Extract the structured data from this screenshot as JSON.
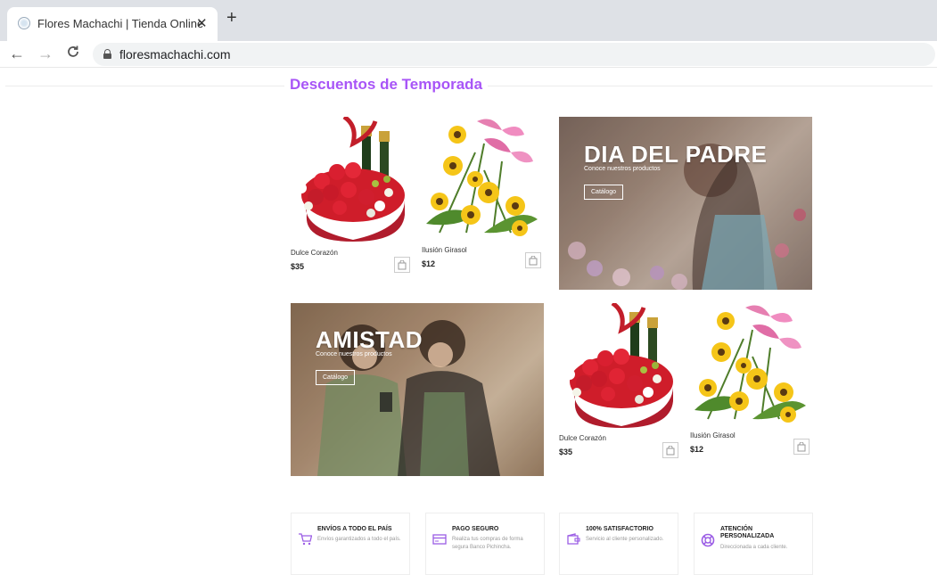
{
  "browser": {
    "tab_title": "Flores Machachi | Tienda Online",
    "tab_close": "✕",
    "new_tab": "+",
    "back": "←",
    "forward": "→",
    "reload": "C",
    "url": "floresmachachi.com"
  },
  "section": {
    "title": "Descuentos de Temporada"
  },
  "products_top": [
    {
      "name": "Dulce Corazón",
      "price": "$35"
    },
    {
      "name": "Ilusión Girasol",
      "price": "$12"
    }
  ],
  "products_bottom": [
    {
      "name": "Dulce Corazón",
      "price": "$35"
    },
    {
      "name": "Ilusión Girasol",
      "price": "$12"
    }
  ],
  "banners": [
    {
      "title": "DIA DEL PADRE",
      "subtitle": "Conoce nuestros productos",
      "button": "Catálogo"
    },
    {
      "title": "AMISTAD",
      "subtitle": "Conoce nuestros productos",
      "button": "Catálogo"
    }
  ],
  "features": [
    {
      "title": "ENVÍOS A TODO EL PAÍS",
      "text": "Envíos garantizados a todo el país.",
      "icon": "cart-icon"
    },
    {
      "title": "PAGO SEGURO",
      "text": "Realiza tus compras de forma segura Banco Pichincha.",
      "icon": "credit-card-icon"
    },
    {
      "title": "100% SATISFACTORIO",
      "text": "Servicio al cliente personalizado.",
      "icon": "wallet-icon"
    },
    {
      "title": "ATENCIÓN PERSONALIZADA",
      "text": "Direccionada a cada cliente.",
      "icon": "lifebuoy-icon"
    }
  ],
  "colors": {
    "accent": "#a855f7",
    "icon_purple": "#9b5de5"
  }
}
